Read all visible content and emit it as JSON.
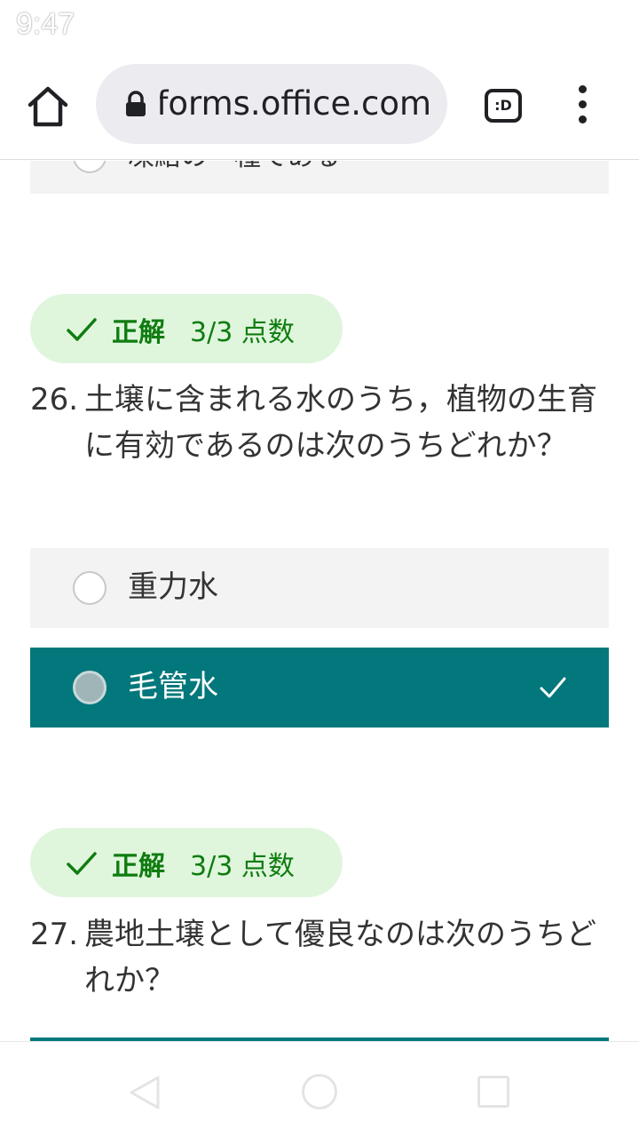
{
  "status_bar": {
    "time": "9:47"
  },
  "browser": {
    "url": "forms.office.com",
    "tab_switcher_label": ":D"
  },
  "prev_question": {
    "option_label_cut": "凍結の一種である"
  },
  "questions": [
    {
      "result_label": "正解",
      "score": "3/3 点数",
      "number": "26.",
      "text": "土壌に含まれる水のうち，植物の生育に有効であるのは次のうちどれか？",
      "options": [
        {
          "label": "重力水",
          "selected": false
        },
        {
          "label": "毛管水",
          "selected": true
        }
      ]
    },
    {
      "result_label": "正解",
      "score": "3/3 点数",
      "number": "27.",
      "text": "農地土壌として優良なのは次のうちどれか？"
    }
  ],
  "colors": {
    "accent": "#03787c",
    "correct_bg": "#dff6dd",
    "correct_text": "#107c10",
    "option_bg": "#f3f3f3"
  },
  "icons": [
    "home-icon",
    "lock-icon",
    "tab-switcher-icon",
    "more-vert-icon",
    "check-icon",
    "back-triangle-icon",
    "home-circle-icon",
    "recents-square-icon"
  ]
}
